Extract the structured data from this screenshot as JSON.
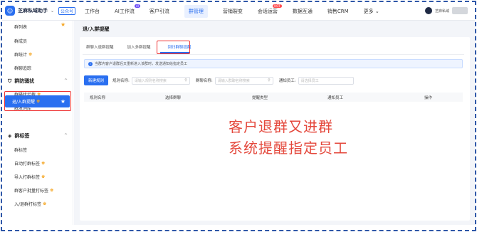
{
  "app": {
    "brand_name": "芝麻私域助手",
    "brand_caret": "⌄",
    "version_tag": "公众号"
  },
  "nav": {
    "items": [
      {
        "label": "工作台",
        "active": false
      },
      {
        "label": "AI工作流",
        "active": false,
        "badge": "AI"
      },
      {
        "label": "客户引流",
        "active": false
      },
      {
        "label": "群管理",
        "active": true
      },
      {
        "label": "营销裂变",
        "active": false
      },
      {
        "label": "会话运营",
        "active": false,
        "badge": "HOT"
      },
      {
        "label": "数据互通",
        "active": false
      },
      {
        "label": "销售CRM",
        "active": false
      },
      {
        "label": "更多 ⌄",
        "active": false
      }
    ],
    "user_label": "芝麻私域"
  },
  "sidebar": {
    "items_top": [
      {
        "label": "群列表",
        "star": true
      },
      {
        "label": "群成员"
      },
      {
        "label": "群统计",
        "vip": true
      },
      {
        "label": "群聊追踪"
      }
    ],
    "group_defense": {
      "label": "群防骚扰",
      "caret": "^"
    },
    "items_mid": [
      {
        "label": "群骚扰拦截",
        "vip": true
      },
      {
        "label": "触发词库"
      }
    ],
    "active_item": {
      "label": "退/入群提醒",
      "vip": true
    },
    "group_tags": {
      "label": "群标签",
      "caret": "^"
    },
    "items_bottom": [
      {
        "label": "群标签"
      },
      {
        "label": "自动打群标签",
        "vip": true
      },
      {
        "label": "导入打群标签",
        "vip": true
      },
      {
        "label": "群客户批量打标签",
        "vip": true
      },
      {
        "label": "入/退群打标签",
        "vip": true
      }
    ],
    "vip_glyph": "♚"
  },
  "main": {
    "title": "退/入群提醒",
    "tabs": [
      {
        "label": "群聊入退群提醒",
        "active": false
      },
      {
        "label": "加入多群提醒",
        "active": false
      },
      {
        "label": "回归群聊提醒",
        "active": true
      }
    ],
    "info_text": "当群内客户退群后又重新进入该群时，发送通知给指定员工",
    "new_button": "新建规则",
    "filters": {
      "rule_label": "规则名称:",
      "rule_placeholder": "请输入规则名称搜索",
      "group_label": "群聊名称:",
      "group_placeholder": "请输入群聊名称搜索",
      "staff_label": "通知员工:",
      "staff_placeholder": "请选择员工"
    },
    "columns": [
      "规则名称",
      "选择群聊",
      "提醒类型",
      "通知员工",
      "操作"
    ]
  },
  "overlay": {
    "line1": "客户退群又进群",
    "line2": "系统提醒指定员工"
  },
  "colors": {
    "accent": "#2a6ff0",
    "highlight_box": "#e33333",
    "overlay_text": "#e4483c",
    "frame_dashed": "#2f57a8"
  }
}
